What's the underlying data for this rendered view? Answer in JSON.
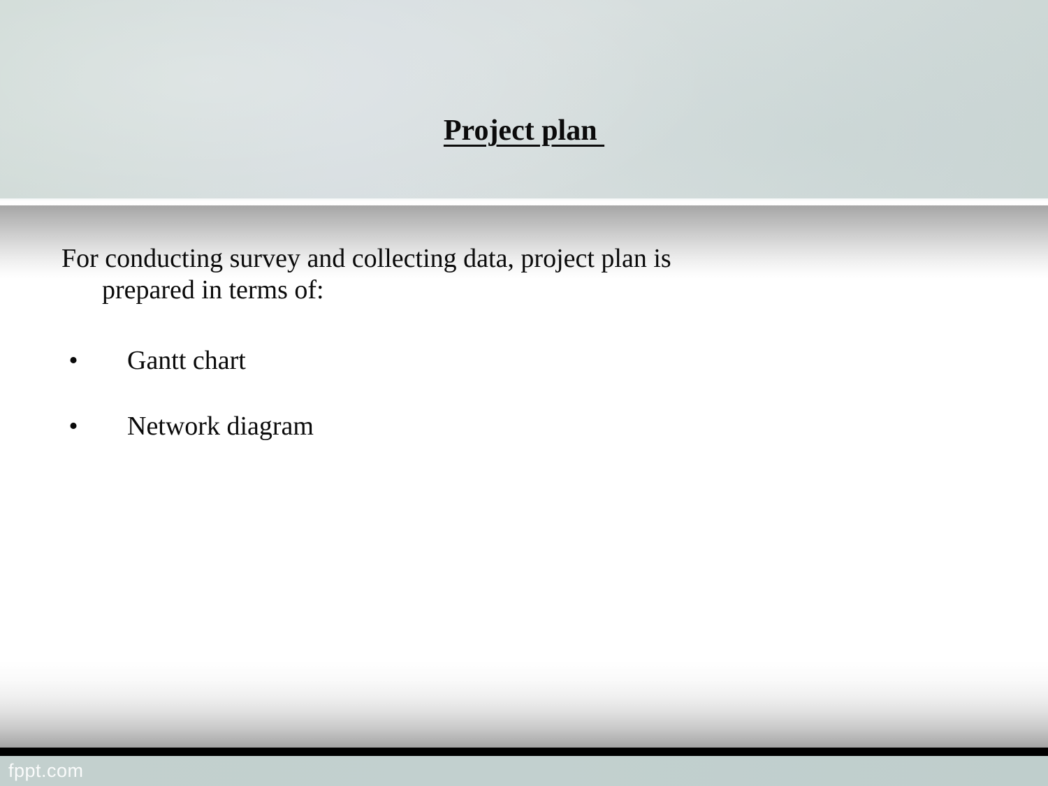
{
  "slide": {
    "title": "Project plan ",
    "intro_main": "For conducting survey and collecting data, project plan is",
    "intro_continuation": "prepared in terms of:",
    "bullets": [
      {
        "marker": "•",
        "label": "Gantt chart"
      },
      {
        "marker": "•",
        "label": "Network diagram"
      }
    ],
    "footer": {
      "watermark": "fppt.com"
    },
    "colors": {
      "header_band": "#d6dddd",
      "header_band_right": "#ccd7d5",
      "footer_band": "#c2d0cf",
      "footer_rule": "#000000",
      "text": "#0a0a0a",
      "page": "#ffffff"
    }
  }
}
